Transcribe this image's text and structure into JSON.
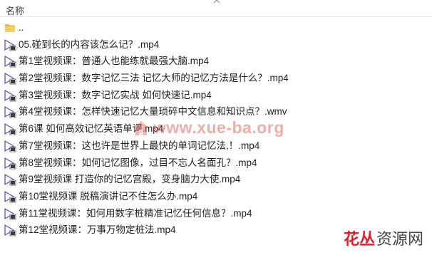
{
  "header": {
    "name_label": "名称"
  },
  "rows": [
    {
      "name": "..",
      "icon": "folder-icon"
    },
    {
      "name": "05.碰到长的内容该怎么记？.mp4",
      "icon": "video-file-icon"
    },
    {
      "name": "第1堂视频课：普通人也能练就最强大脑.mp4",
      "icon": "video-file-icon"
    },
    {
      "name": "第2堂视频课：数字记忆三法  记忆大师的记忆方法是什么？.mp4",
      "icon": "video-file-icon"
    },
    {
      "name": "第3堂视频课：数字记忆实战  如何快速记.mp4",
      "icon": "video-file-icon"
    },
    {
      "name": "第4堂视频课：怎样快速记忆大量琐碎中文信息和知识点？.wmv",
      "icon": "video-file-icon"
    },
    {
      "name": "第6课 如何高效记忆英语单词.mp4",
      "icon": "video-file-icon"
    },
    {
      "name": "第7堂视频课：这也许是世界上最快的单词记忆法,！.mp4",
      "icon": "video-file-icon"
    },
    {
      "name": "第8堂视频课：如何记忆图像，过目不忘人名面孔？.mp4",
      "icon": "video-file-icon"
    },
    {
      "name": "第9堂视频课 打造你的记忆宫殿，变身脑力大使.mp4",
      "icon": "video-file-icon"
    },
    {
      "name": "第10堂视频课 脱稿演讲记不住怎么办.mp4",
      "icon": "video-file-icon"
    },
    {
      "name": "第11堂视频课：如何用数字桩精准记忆任何信息？.mp4",
      "icon": "video-file-icon"
    },
    {
      "name": "第12堂视频课：万事万物定桩法.mp4",
      "icon": "video-file-icon"
    }
  ],
  "watermark": {
    "text": "www.xue-ba.org"
  },
  "brand": {
    "main": "花丛",
    "sub": "资源网"
  },
  "colors": {
    "folder": "#e8b84a",
    "video_icon": "#6a5acd",
    "watermark": "#e1463c",
    "brand_red": "#d9232e"
  }
}
